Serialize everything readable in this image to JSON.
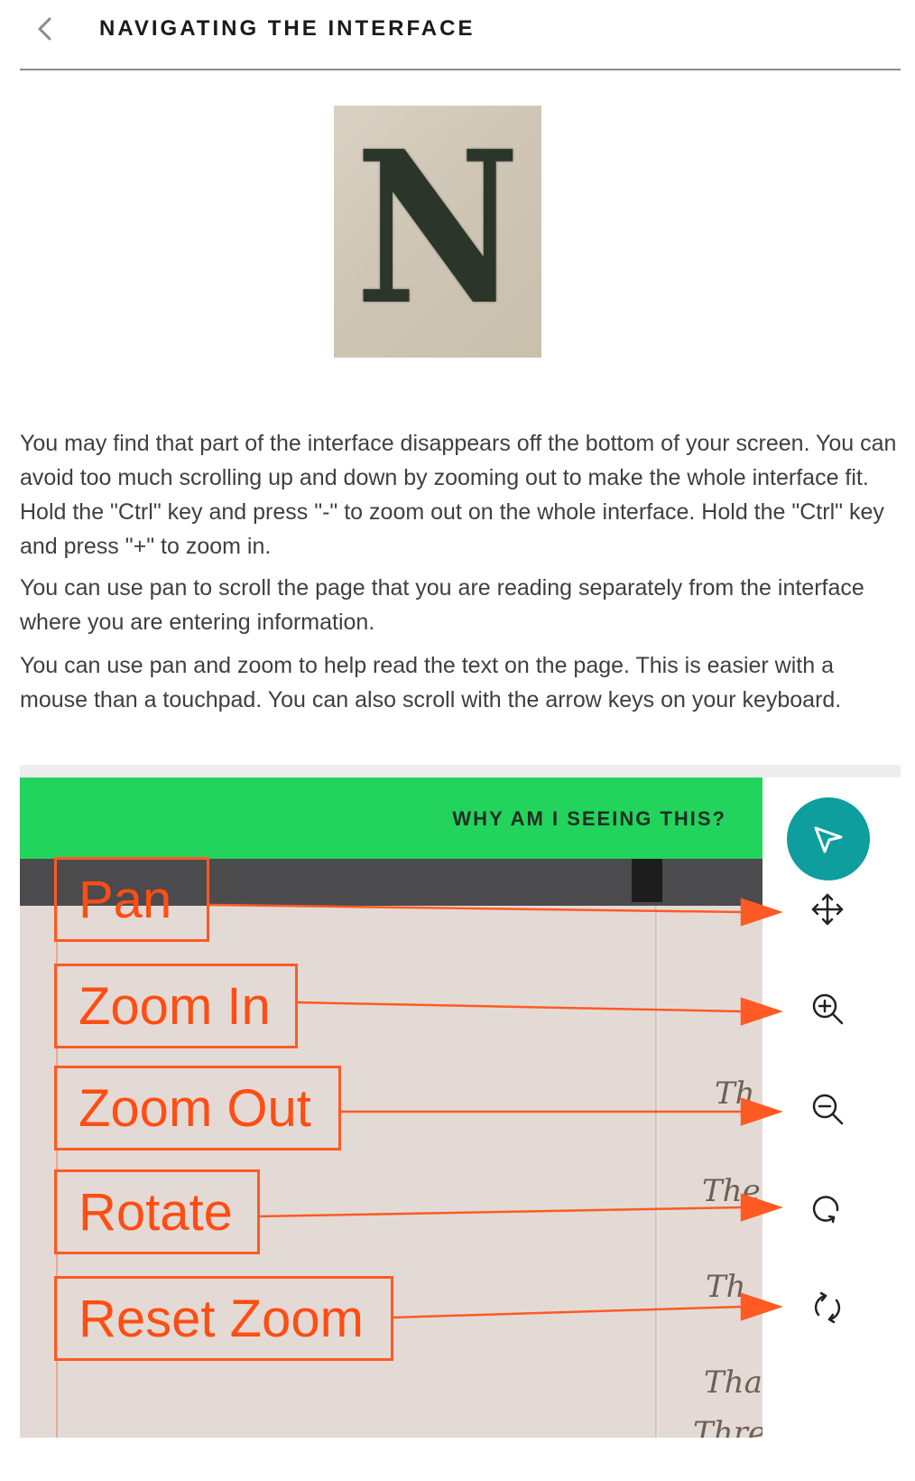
{
  "header": {
    "back_icon": "chevron-left-icon",
    "title": "NAVIGATING THE INTERFACE"
  },
  "example_image": {
    "letter": "N"
  },
  "paragraphs": [
    "You may find that part of the interface disappears off the bottom of your screen. You can avoid too much scrolling up and down by zooming out to make the whole interface fit. Hold the \"Ctrl\" key and press \"-\" to zoom out on the whole interface. Hold the \"Ctrl\" key and press \"+\" to zoom in.",
    "You can use pan to scroll the page that you are reading separately from the interface where you are entering information.",
    "You can use pan and zoom to help read the text on the page. This is easier with a mouse than a touchpad. You can also scroll with the arrow keys on your keyboard."
  ],
  "illustration": {
    "banner_link": "WHY AM I SEEING THIS?",
    "banner_color": "#22d45c",
    "fab_color": "#0e9e9e",
    "callout_color": "#ff5a24",
    "fab_icon": "pointer-arrow-icon",
    "callouts": [
      {
        "label": "Pan",
        "icon": "move-arrows-icon"
      },
      {
        "label": "Zoom In",
        "icon": "zoom-in-icon"
      },
      {
        "label": "Zoom Out",
        "icon": "zoom-out-icon"
      },
      {
        "label": "Rotate",
        "icon": "rotate-icon"
      },
      {
        "label": "Reset Zoom",
        "icon": "reset-zoom-icon"
      }
    ],
    "handwriting": [
      "Th",
      "The",
      "Th",
      "Tha",
      "Thre"
    ]
  }
}
